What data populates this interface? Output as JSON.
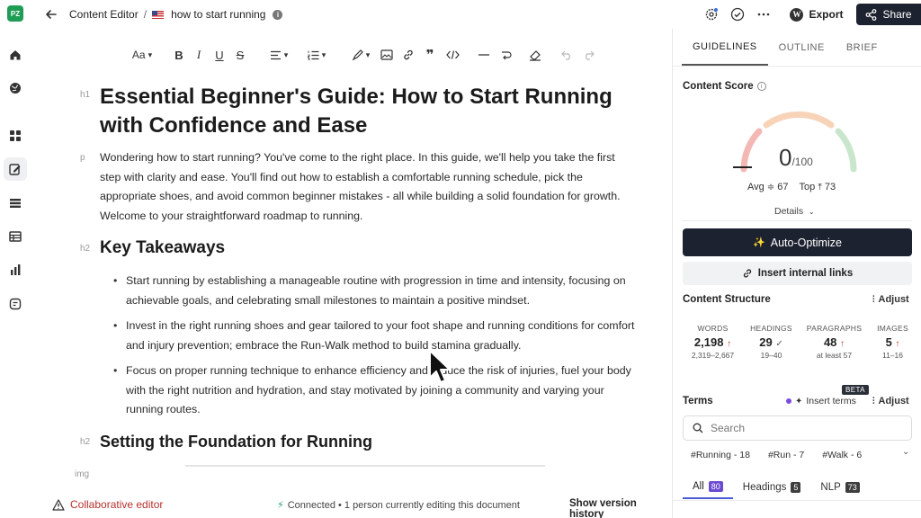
{
  "app": {
    "logo_text": "PZ",
    "breadcrumb_root": "Content Editor",
    "breadcrumb_sep": "/",
    "document_title": "how to start running"
  },
  "header": {
    "export_label": "Export",
    "share_label": "Share"
  },
  "toolbar": {
    "font_label": "Aa",
    "bold": "B",
    "italic": "I",
    "underline": "U",
    "strike": "S"
  },
  "editor": {
    "tag_h1": "h1",
    "tag_p": "p",
    "tag_h2": "h2",
    "tag_img": "img",
    "title": "Essential Beginner's Guide: How to Start Running with Confidence and Ease",
    "intro": "Wondering how to start running? You've come to the right place. In this guide, we'll help you take the first step with clarity and ease. You'll find out how to establish a comfortable running schedule, pick the appropriate shoes, and avoid common beginner mistakes - all while building a solid foundation for growth. Welcome to your straightforward roadmap to running.",
    "h2_takeaways": "Key Takeaways",
    "bullets": [
      "Start running by establishing a manageable routine with progression in time and intensity, focusing on achievable goals, and celebrating small milestones to maintain a positive mindset.",
      "Invest in the right running shoes and gear tailored to your foot shape and running conditions for comfort and injury prevention; embrace the Run-Walk method to build stamina gradually.",
      "Focus on proper running technique to enhance efficiency and reduce the risk of injuries, fuel your body with the right nutrition and hydration, and stay motivated by joining a community and varying your running routes."
    ],
    "h2_foundation": "Setting the Foundation for Running"
  },
  "status": {
    "collab_label": "Collaborative editor",
    "connected_text": "Connected • 1 person currently editing this document",
    "version_label": "Show version history"
  },
  "panel": {
    "tabs": [
      "GUIDELINES",
      "OUTLINE",
      "BRIEF"
    ],
    "content_score_label": "Content Score",
    "score": "0",
    "score_max": "/100",
    "avg_label": "Avg",
    "avg_value": "67",
    "top_label": "Top",
    "top_value": "73",
    "details_label": "Details",
    "auto_optimize_label": "Auto-Optimize",
    "internal_links_label": "Insert internal links",
    "structure_title": "Content Structure",
    "adjust_label": "Adjust",
    "stats": [
      {
        "label": "WORDS",
        "value": "2,198",
        "mark": "↑",
        "range": "2,319–2,667"
      },
      {
        "label": "HEADINGS",
        "value": "29",
        "mark": "✓",
        "range": "19–40"
      },
      {
        "label": "PARAGRAPHS",
        "value": "48",
        "mark": "↑",
        "range": "at least 57"
      },
      {
        "label": "IMAGES",
        "value": "5",
        "mark": "↑",
        "range": "11–16"
      }
    ],
    "terms_title": "Terms",
    "insert_terms_label": "Insert terms",
    "beta_label": "BETA",
    "search_placeholder": "Search",
    "chips": [
      "#Running - 18",
      "#Run - 7",
      "#Walk - 6"
    ],
    "filter_tabs": [
      {
        "label": "All",
        "count": "80"
      },
      {
        "label": "Headings",
        "count": "5"
      },
      {
        "label": "NLP",
        "count": "73"
      }
    ]
  },
  "colors": {
    "accent_dark": "#1d2230",
    "warning_red": "#b5322f",
    "connected_green": "#26a269",
    "badge_purple": "#6b4bd1",
    "gauge_red": "#f3b8b4",
    "gauge_orange": "#f7d3b8",
    "gauge_green": "#c9e6cc"
  }
}
